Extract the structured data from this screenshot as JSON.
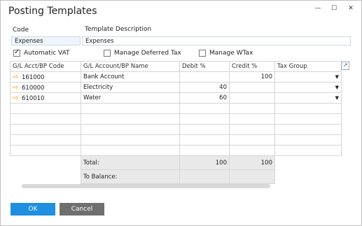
{
  "window": {
    "title": "Posting Templates",
    "min_glyph": "—",
    "max_glyph": "☐",
    "close_glyph": "✕"
  },
  "header": {
    "code_label": "Code",
    "code_value": "Expenses",
    "desc_label": "Template Description",
    "desc_value": "Expenses"
  },
  "options": {
    "auto_vat_label": "Automatic VAT",
    "auto_vat_checked": true,
    "deferred_tax_label": "Manage Deferred Tax",
    "deferred_tax_checked": false,
    "wtax_label": "Manage WTax",
    "wtax_checked": false
  },
  "table": {
    "columns": [
      "G/L Acct/BP Code",
      "G/L Account/BP Name",
      "Debit %",
      "Credit %",
      "Tax Group"
    ],
    "rows": [
      {
        "code": "161000",
        "name": "Bank Account",
        "debit": "",
        "credit": "100"
      },
      {
        "code": "610000",
        "name": "Electricity",
        "debit": "40",
        "credit": ""
      },
      {
        "code": "610010",
        "name": "Water",
        "debit": "60",
        "credit": ""
      }
    ],
    "total_label": "Total:",
    "total_debit": "100",
    "total_credit": "100",
    "balance_label": "To Balance:"
  },
  "buttons": {
    "ok": "OK",
    "cancel": "Cancel"
  },
  "icons": {
    "row_link": "orange-arrow-icon",
    "expand": "expand-arrow-icon",
    "dropdown": "dropdown-triangle-icon"
  }
}
